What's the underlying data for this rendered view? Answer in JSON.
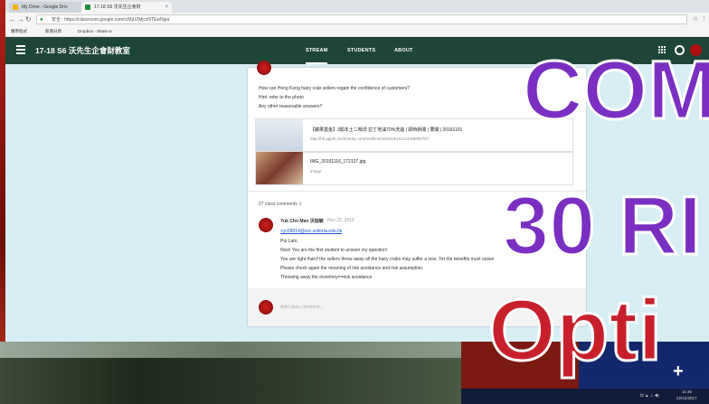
{
  "browser": {
    "tabs": [
      {
        "title": "My Drive - Google Driv",
        "color": "#f5b400"
      },
      {
        "title": "17-18 S6 沃先生企會財",
        "color": "#1e8e3e"
      }
    ],
    "url_secure_label": "安全",
    "url": "https://classroom.google.com/c/MjU2MjcxNTEwNjpa",
    "bookmarks": [
      "應用程式",
      "新增分頁",
      "Dropbox - Share w"
    ]
  },
  "classroom": {
    "class_title": "17-18 S6 沃先生企會財教室",
    "nav_tabs": [
      "STREAM",
      "STUDENTS",
      "ABOUT"
    ],
    "header_color": "#1e4637"
  },
  "post": {
    "lines": [
      "How can Hong Kong hairy crab sellers regain the confidence of customers?",
      "Hint: refer to the photo",
      "Any other reasonable answers?"
    ],
    "attachments": [
      {
        "title": "【蘋果基金】3間本土二噸洋 拉丁地油70%洗邊 | 即時新聞 | 要聞 | 20161101",
        "subtitle": "http://hk.apple.nextmedia.com/realtime/news/20161101/55850767"
      },
      {
        "title": "IMG_20161116_172137.jpg",
        "subtitle": "Image"
      }
    ],
    "comment_count": "27 class comments",
    "comment": {
      "author": "Yuk Cho Man 沃旭敏",
      "date": "Nov 22, 2016",
      "mention": "+yc08014@ssc.ssltorta.edu.hk",
      "lines": [
        "Pui Lam,",
        "Nice! You are the first student to answer my question!",
        "You are right that if the sellers throw away all the hairy crabs may suffer a loss. Yet the benefits must outwe",
        "Please check again the meaning of risk avoidance and risk assumption.",
        "Throwing away the inventory==risk avoidance"
      ]
    },
    "add_comment_placeholder": "Add class comment..."
  },
  "overlay": {
    "line1": "COM",
    "line2": "30 RI",
    "line3": "Opti",
    "line1_color": "#7a2fc2",
    "line3_color": "#c8202a"
  },
  "taskbar": {
    "time": "11:46",
    "date": "22/12/2017"
  }
}
